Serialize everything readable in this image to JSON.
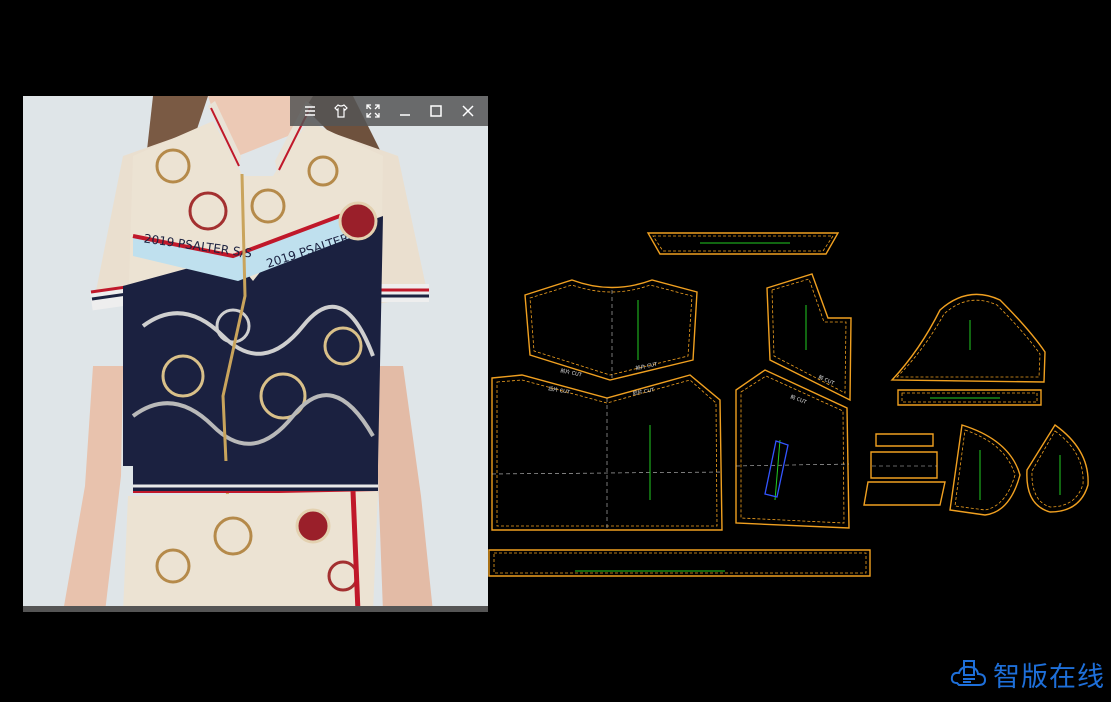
{
  "viewer": {
    "photo_text": "2019 PSALTER S/S",
    "toolbar": {
      "menu_icon": "menu-icon",
      "garment_icon": "tshirt-icon",
      "fullscreen_icon": "fullscreen-icon",
      "minimize_icon": "minimize-icon",
      "maximize_icon": "maximize-icon",
      "close_icon": "close-icon"
    }
  },
  "cad": {
    "line_color": "#f0a020",
    "grain_color": "#22cc22",
    "pieces": [
      "waist-band",
      "front-yoke",
      "back-yoke",
      "sleeve",
      "cuff",
      "back-body",
      "front-body",
      "collar",
      "facing-small",
      "facing-left",
      "facing-right",
      "bottom-band"
    ]
  },
  "brand": {
    "name": "智版在线",
    "color": "#1e6fd9"
  }
}
